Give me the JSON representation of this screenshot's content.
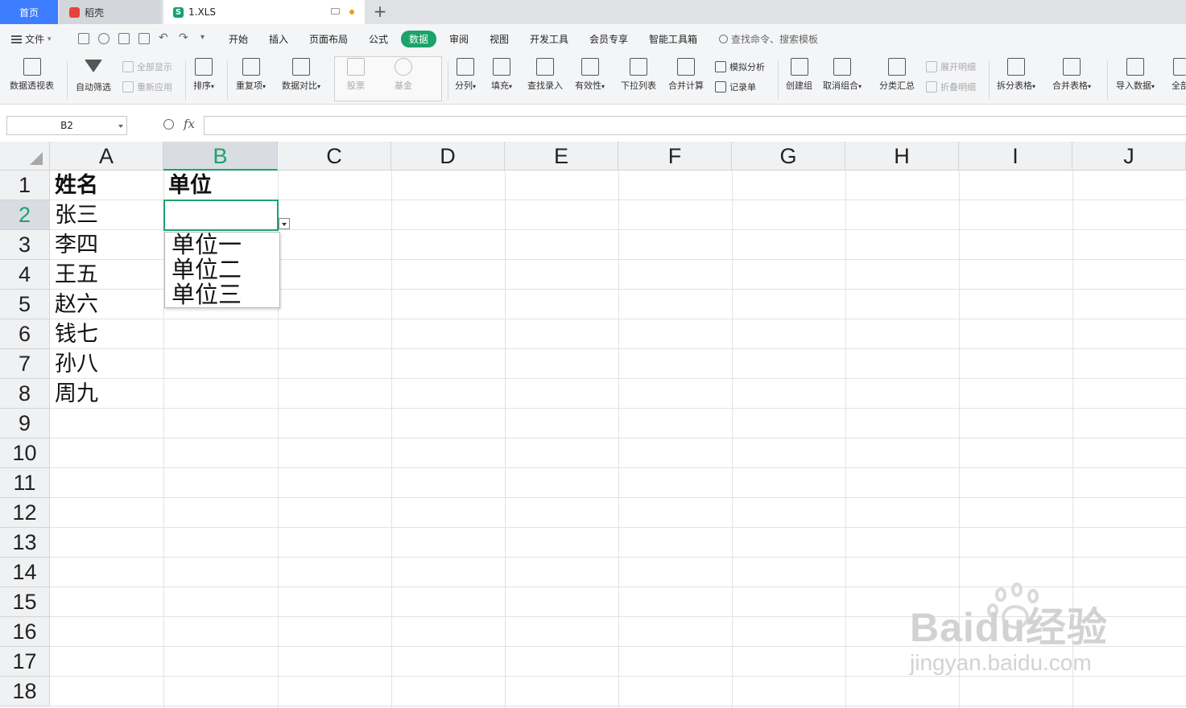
{
  "tabs": [
    {
      "label": "首页",
      "active": false
    },
    {
      "label": "稻壳",
      "active": false
    },
    {
      "label": "1.XLS",
      "active": true
    }
  ],
  "menu": {
    "file_label": "文件",
    "tabs": [
      "开始",
      "插入",
      "页面布局",
      "公式",
      "数据",
      "审阅",
      "视图",
      "开发工具",
      "会员专享",
      "智能工具箱"
    ],
    "active_tab": "数据",
    "search_placeholder": "查找命令、搜索模板"
  },
  "ribbon": {
    "pivot": "数据透视表",
    "autofilter": "自动筛选",
    "show_all": "全部显示",
    "reapply": "重新应用",
    "sort": "排序",
    "duplicates": "重复项",
    "compare": "数据对比",
    "stocks": "股票",
    "funds": "基金",
    "split": "分列",
    "fill": "填充",
    "lookup": "查找录入",
    "validity": "有效性",
    "dropdown_list": "下拉列表",
    "consolidate": "合并计算",
    "what_if": "模拟分析",
    "record_form": "记录单",
    "group": "创建组",
    "ungroup": "取消组合",
    "subtotal": "分类汇总",
    "expand_detail": "展开明细",
    "collapse_detail": "折叠明细",
    "split_table": "拆分表格",
    "merge_table": "合并表格",
    "import_data": "导入数据",
    "full_partial": "全部"
  },
  "formula_bar": {
    "name_box": "B2",
    "fx": "fx",
    "value": ""
  },
  "sheet": {
    "columns": [
      "A",
      "B",
      "C",
      "D",
      "E",
      "F",
      "G",
      "H",
      "I",
      "J"
    ],
    "rows": [
      "1",
      "2",
      "3",
      "4",
      "5",
      "6",
      "7",
      "8",
      "9",
      "10",
      "11",
      "12",
      "13",
      "14",
      "15",
      "16",
      "17",
      "18"
    ],
    "selected_cell": "B2",
    "cells": {
      "A1": "姓名",
      "B1": "单位",
      "A2": "张三",
      "A3": "李四",
      "A4": "王五",
      "A5": "赵六",
      "A6": "钱七",
      "A7": "孙八",
      "A8": "周九"
    },
    "dropdown_options": [
      "单位一",
      "单位二",
      "单位三"
    ]
  },
  "watermark": {
    "main": "Baidu经验",
    "sub": "jingyan.baidu.com"
  },
  "colors": {
    "accent": "#1aa36a",
    "home_tab": "#3d7eff",
    "file_icon": "#13a36b",
    "daoke_icon": "#e8413c"
  }
}
